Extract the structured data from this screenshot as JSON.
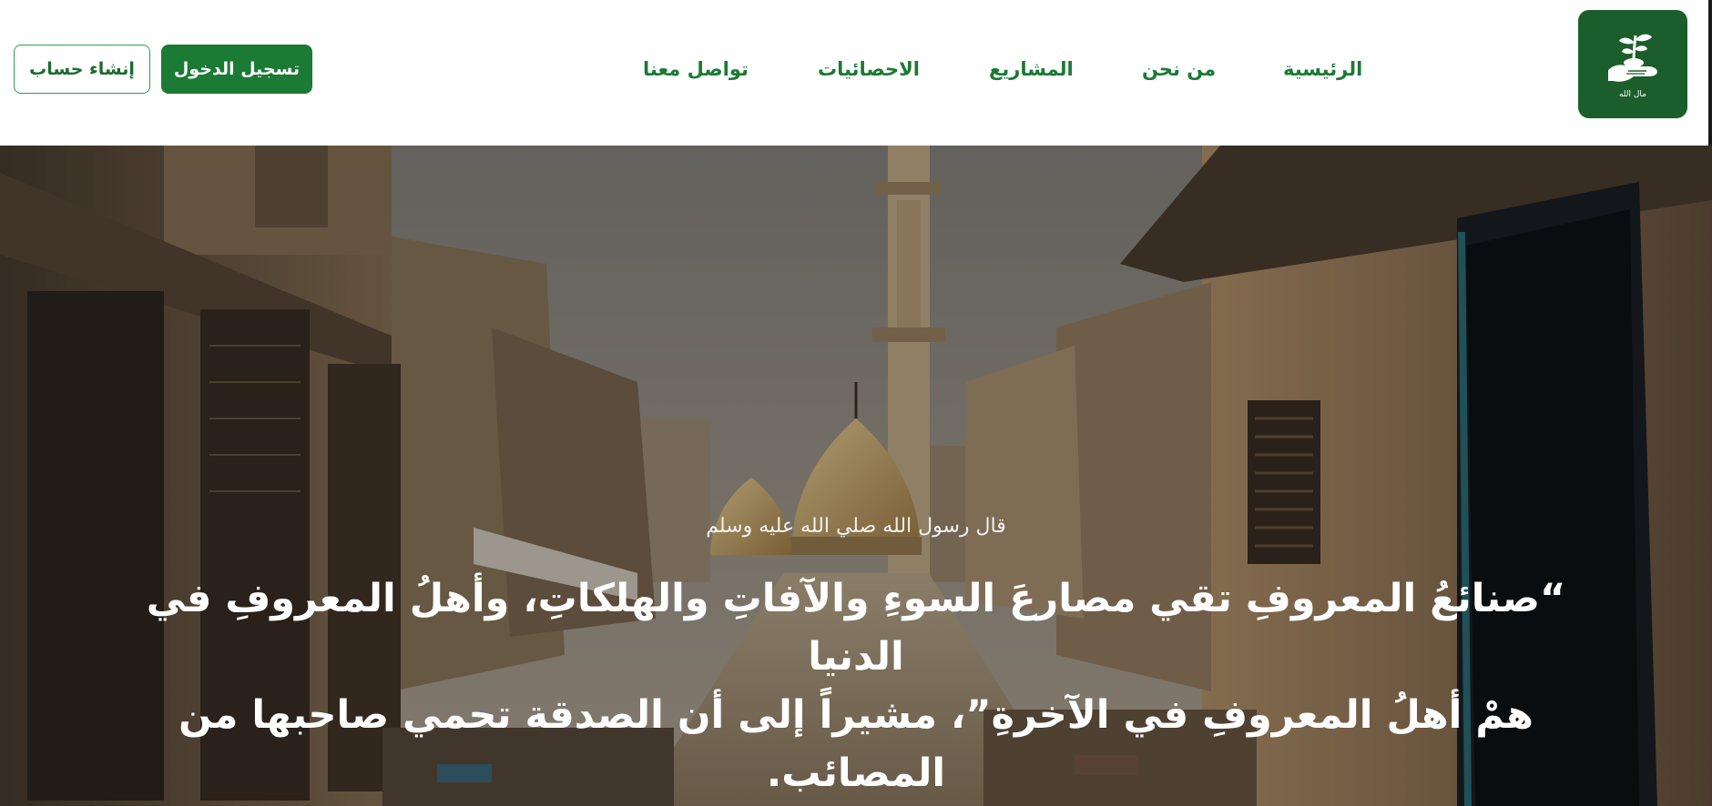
{
  "header": {
    "logo": {
      "text": "مال الله",
      "icon": "hand-plant-icon"
    },
    "nav": [
      {
        "id": "home",
        "label": "الرئيسية"
      },
      {
        "id": "about",
        "label": "من نحن"
      },
      {
        "id": "projects",
        "label": "المشاريع"
      },
      {
        "id": "stats",
        "label": "الاحصائيات"
      },
      {
        "id": "contact",
        "label": "تواصل معنا"
      }
    ],
    "login_label": "تسجيل الدخول",
    "register_label": "إنشاء حساب"
  },
  "hero": {
    "caption": "قال رسول الله صلي الله عليه وسلم",
    "quote_line1": "“صنائعُ المعروفِ تقي مصارعَ السوءِ والآفاتِ والهلكاتِ، وأهلُ المعروفِ في الدنيا",
    "quote_line2": "همْ أهلُ المعروفِ في الآخرةِ”، مشيراً إلى أن الصدقة تحمي صاحبها من المصائب."
  },
  "colors": {
    "brand_green": "#1b7a34",
    "logo_bg": "#1b5e2b"
  }
}
